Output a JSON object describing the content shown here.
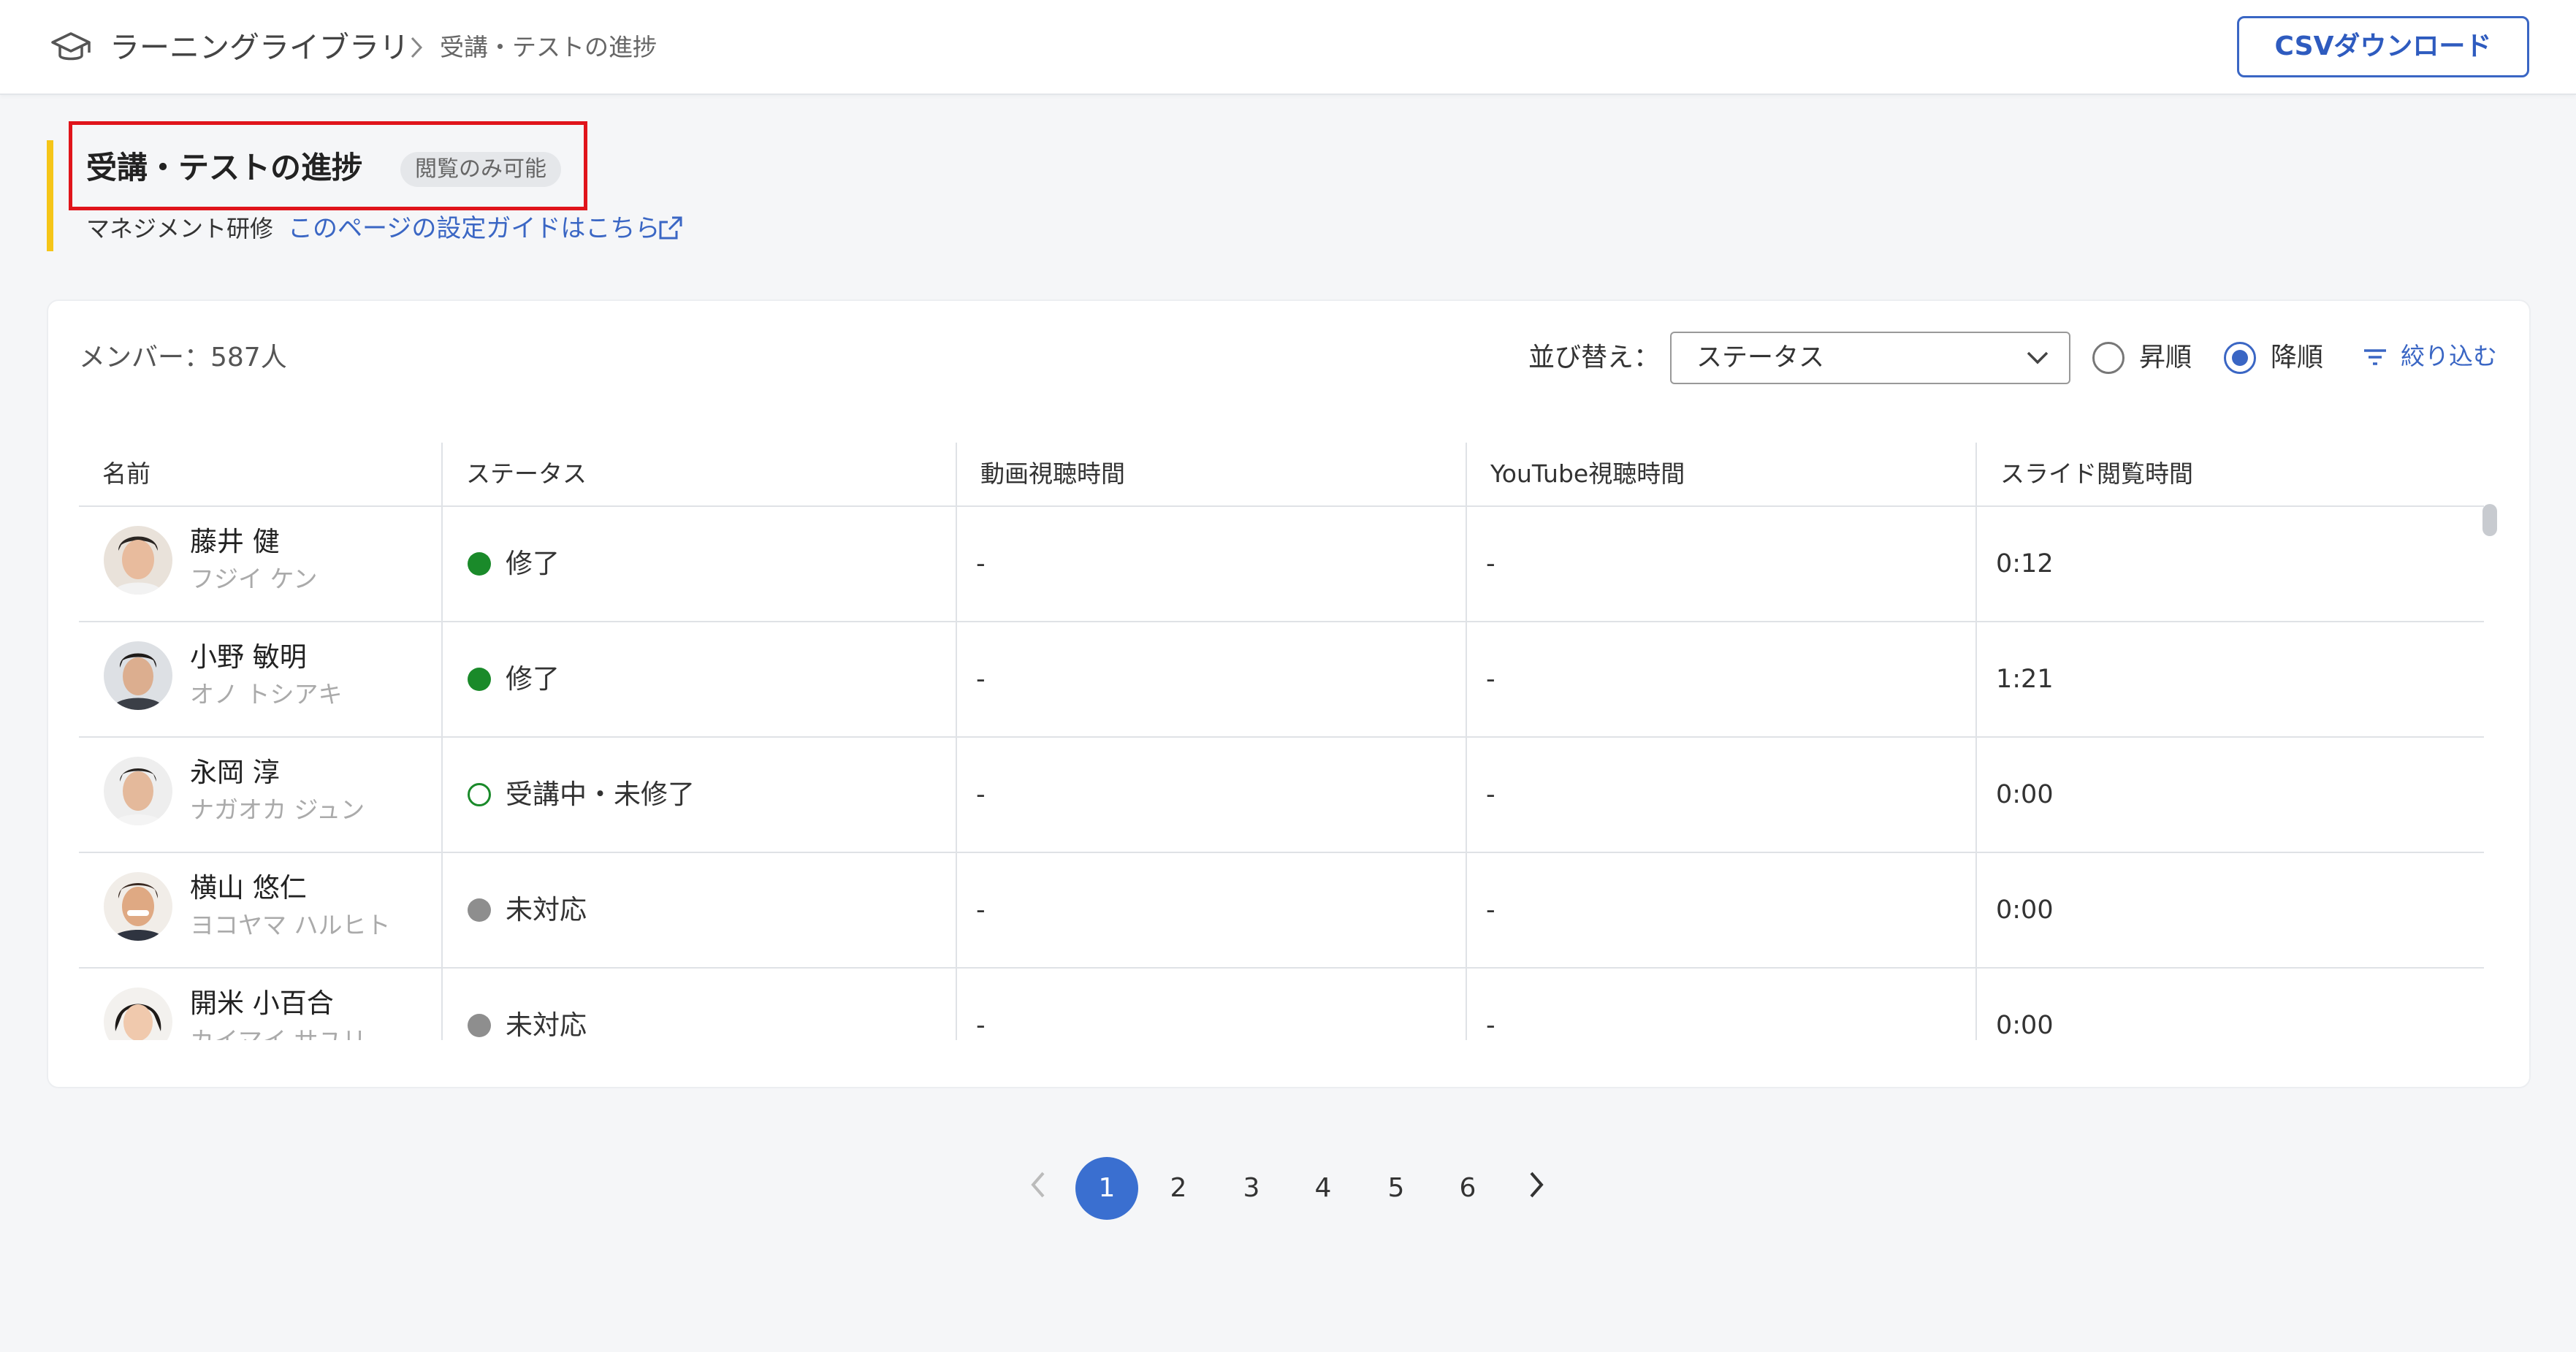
{
  "header": {
    "breadcrumb_root": "ラーニングライブラリ",
    "breadcrumb_current": "受講・テストの進捗",
    "csv_button": "CSVダウンロード"
  },
  "page": {
    "title": "受講・テストの進捗",
    "badge": "閲覧のみ可能",
    "course_name": "マネジメント研修",
    "guide_link": "このページの設定ガイドはこちら"
  },
  "toolbar": {
    "member_count": "メンバー：587人",
    "sort_label": "並び替え：",
    "sort_value": "ステータス",
    "asc_label": "昇順",
    "desc_label": "降順",
    "order_selected": "desc",
    "filter_label": "絞り込む"
  },
  "table": {
    "columns": [
      "名前",
      "ステータス",
      "動画視聴時間",
      "YouTube視聴時間",
      "スライド閲覧時間"
    ],
    "rows": [
      {
        "name": "藤井 健",
        "kana": "フジイ ケン",
        "status": "修了",
        "status_type": "done",
        "video": "-",
        "youtube": "-",
        "slide": "0:12"
      },
      {
        "name": "小野 敏明",
        "kana": "オノ トシアキ",
        "status": "修了",
        "status_type": "done",
        "video": "-",
        "youtube": "-",
        "slide": "1:21"
      },
      {
        "name": "永岡 淳",
        "kana": "ナガオカ ジュン",
        "status": "受講中・未修了",
        "status_type": "progress",
        "video": "-",
        "youtube": "-",
        "slide": "0:00"
      },
      {
        "name": "横山 悠仁",
        "kana": "ヨコヤマ ハルヒト",
        "status": "未対応",
        "status_type": "none",
        "video": "-",
        "youtube": "-",
        "slide": "0:00"
      },
      {
        "name": "開米 小百合",
        "kana": "カイマイ サユリ",
        "status": "未対応",
        "status_type": "none",
        "video": "-",
        "youtube": "-",
        "slide": "0:00"
      }
    ]
  },
  "pagination": {
    "pages": [
      "1",
      "2",
      "3",
      "4",
      "5",
      "6"
    ],
    "current": "1"
  },
  "colors": {
    "accent": "#3a66c4",
    "status_done": "#1a8a2a",
    "status_none": "#8e8e8e",
    "highlight": "#e0141b",
    "title_bar": "#f5c518"
  }
}
